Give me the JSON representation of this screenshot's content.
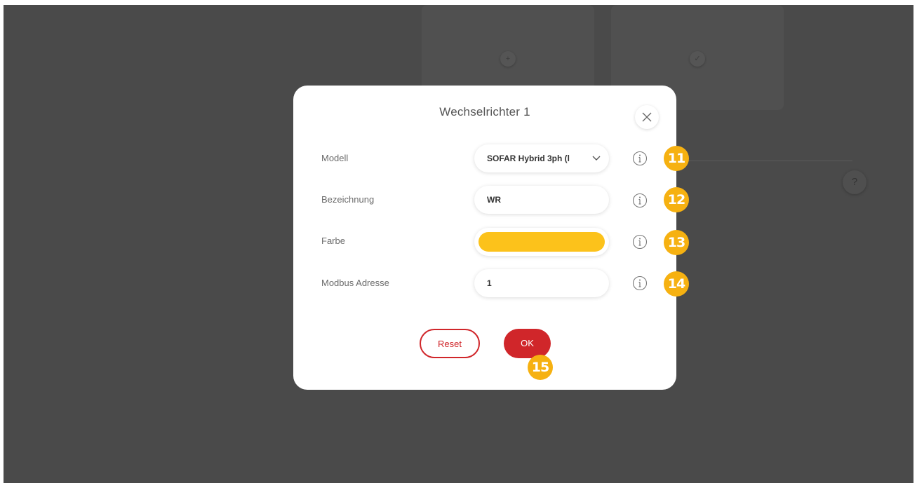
{
  "background": {
    "help_symbol": "?"
  },
  "dialog": {
    "title": "Wechselrichter 1",
    "close_icon": "close-icon",
    "fields": {
      "modell": {
        "label": "Modell",
        "value": "SOFAR Hybrid 3ph (l",
        "badge": "11"
      },
      "bezeichnung": {
        "label": "Bezeichnung",
        "value": "WR",
        "badge": "12"
      },
      "farbe": {
        "label": "Farbe",
        "color": "#fcc21b",
        "badge": "13"
      },
      "modbus": {
        "label": "Modbus Adresse",
        "value": "1",
        "badge": "14"
      }
    },
    "buttons": {
      "reset": "Reset",
      "ok": "OK",
      "ok_badge": "15"
    }
  },
  "colors": {
    "accent_red": "#d0262a",
    "badge_orange": "#f6b111",
    "backdrop": "#4a4a4a"
  }
}
